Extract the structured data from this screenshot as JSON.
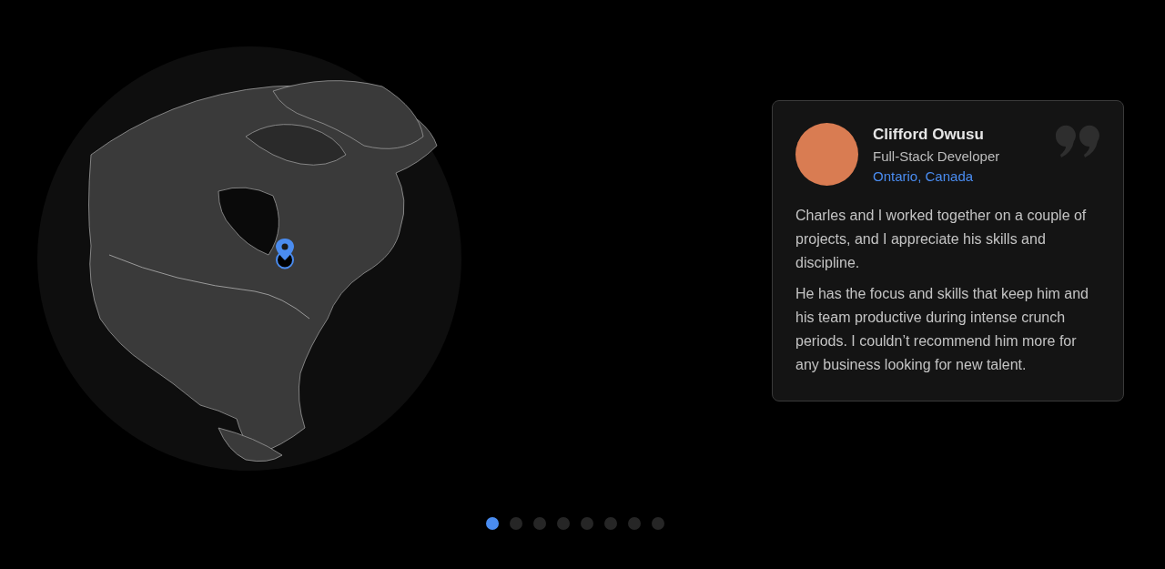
{
  "testimonial": {
    "name": "Clifford Owusu",
    "role": "Full-Stack Developer",
    "location": "Ontario, Canada",
    "paragraphs": [
      "Charles and I worked together on a couple of projects, and I appreciate his skills and discipline.",
      "He has the focus and skills that keep him and his team productive during intense crunch periods. I couldn’t recommend him more for any business looking for new talent."
    ]
  },
  "pagination": [
    {
      "selected": true
    },
    {
      "selected": false
    },
    {
      "selected": false
    },
    {
      "selected": false
    },
    {
      "selected": false
    },
    {
      "selected": false
    },
    {
      "selected": false
    },
    {
      "selected": false
    }
  ]
}
